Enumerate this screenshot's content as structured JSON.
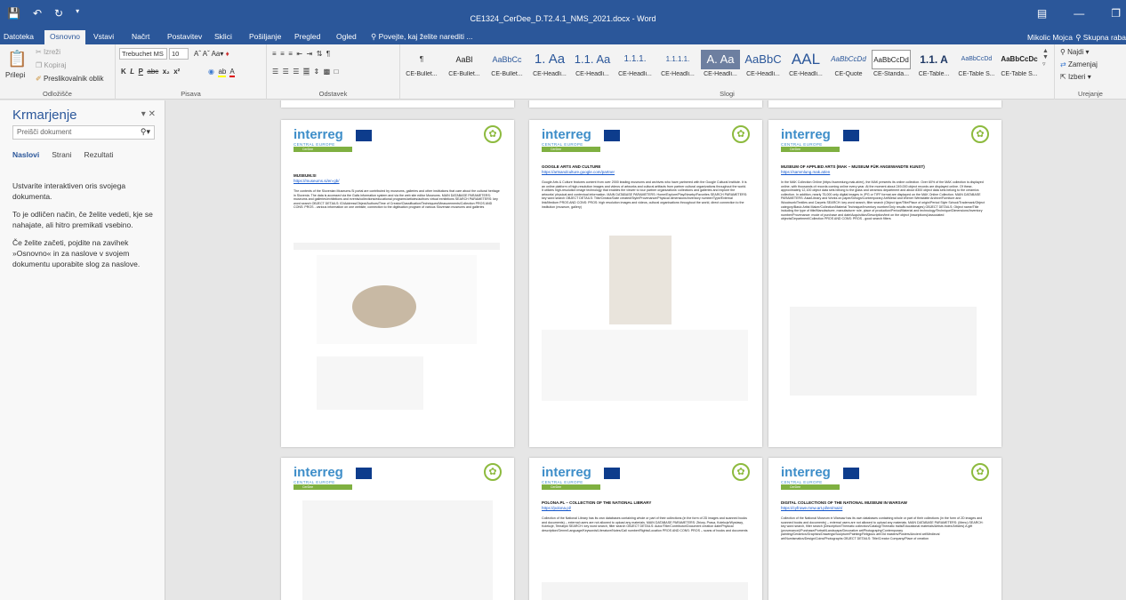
{
  "title_bar": {
    "quick_access": [
      "save-icon",
      "undo-icon",
      "redo-icon"
    ],
    "doc_title": "CE1324_CerDee_D.T2.4.1_NMS_2021.docx - Word",
    "window": [
      "ribbon-display-icon",
      "minimize-icon",
      "restore-icon"
    ]
  },
  "tabs": [
    "Datoteka",
    "Osnovno",
    "Vstavi",
    "Načrt",
    "Postavitev",
    "Sklici",
    "Pošiljanje",
    "Pregled",
    "Ogled",
    "Povejte, kaj želite narediti ..."
  ],
  "user": "Mikolic Mojca",
  "share": "Skupna raba",
  "ribbon": {
    "clipboard": {
      "paste": "Prilepi",
      "cut": "Izreži",
      "copy": "Kopiraj",
      "format_painter": "Preslikovalnik oblik",
      "label": "Odložišče"
    },
    "font": {
      "name": "Trebuchet MS",
      "size": "10",
      "buttons": [
        "K",
        "L",
        "P",
        "abc",
        "x₂",
        "x²"
      ],
      "label": "Pisava"
    },
    "paragraph": {
      "label": "Odstavek"
    },
    "styles": {
      "label": "Slogi",
      "items": [
        {
          "preview": "¶",
          "name": "CE-Bullet..."
        },
        {
          "preview": "AaBl",
          "name": "CE-Bullet..."
        },
        {
          "preview": "AaBbCc",
          "name": "CE-Bullet..."
        },
        {
          "preview": "1. Aa",
          "name": "CE-Headli..."
        },
        {
          "preview": "1.1. Aa",
          "name": "CE-Headli..."
        },
        {
          "preview": "1.1.1.",
          "name": "CE-Headli..."
        },
        {
          "preview": "1.1.1.1.",
          "name": "CE-Headli..."
        },
        {
          "preview": "A. Aa",
          "name": "CE-Headli..."
        },
        {
          "preview": "AaBbC",
          "name": "CE-Headli..."
        },
        {
          "preview": "AAL",
          "name": "CE-Headli..."
        },
        {
          "preview": "AaBbCcDd",
          "name": "CE-Quote"
        },
        {
          "preview": "AaBbCcDd",
          "name": "CE-Standa..."
        },
        {
          "preview": "1.1. A",
          "name": "CE-Table..."
        },
        {
          "preview": "AaBbCcDd",
          "name": "CE-Table S..."
        },
        {
          "preview": "AaBbCcDc",
          "name": "CE-Table S..."
        }
      ]
    },
    "editing": {
      "find": "Najdi",
      "replace": "Zamenjaj",
      "select": "Izberi",
      "label": "Urejanje"
    }
  },
  "nav_pane": {
    "title": "Krmarjenje",
    "search_placeholder": "Preišči dokument",
    "tabs": [
      "Naslovi",
      "Strani",
      "Rezultati"
    ],
    "p1": "Ustvarite interaktiven oris svojega dokumenta.",
    "p2": "To je odličen način, če želite vedeti, kje se nahajate, ali hitro premikati vsebino.",
    "p3": "Če želite začeti, pojdite na zavihek »Osnovno« in za naslove v svojem dokumentu uporabite slog za naslove."
  },
  "pages": [
    {
      "title": "MUSEUM.SI",
      "link": "https://museums.si/en-gb/",
      "body": "The contents of the Slovenian Museums.Si portal are contributed by museums, galleries and other institutions that care about the cultural heritage in Slovenia. The data is accessed via the Galis information system and via the web site editor Museums. MAIN DATABASE PARAMETERS: museums and galleries/exhibitions and events/collections/educational programs/articles/authors virtual exhibitions SEARCH PARAMETERS: key word search OBJECT DETAILS: ID/Address/Object/Authors/Time of Creator/Classification/Techniques/Measurements/Collection PROS AND CONS: PROS - various information on one website, connection to the digitisation program of various Slovenian museums and galleries"
    },
    {
      "title": "GOOGLE ARTS AND CULTURE",
      "link": "https://artsandculture.google.com/partner",
      "body": "Google Arts & Culture features content from over 2000 leading museums and archives who have partnered with the Google Cultural Institute. It is an online platform of high-resolution images and videos of artworks and cultural artifacts from partner cultural organizations throughout the world. It utilizes high-resolution image technology that enables the viewer to tour partner organizations' collections and galleries and explore the artworks' physical and contextual information. MAIN DATABASE PARAMETERS: Home/Explore/Play/Nearby/Favorites SEARCH PARAMETERS: key word search OBJECT DETAILS: Title/Creator/Date created/Style/Provenance/Physical dimensions/Inventory number/Type/External link/Medium PROS AND CONS: PROS: high resolution images and videos, cultural organisations throughout the world, direct connection to the institution (museum, gallery)"
    },
    {
      "title": "MUSEUM OF APPLIED ARTS (MAK – MUSEUM FÜR ANGEWANDTE KUNST)",
      "link": "https://sammlung.mak.at/en",
      "body": "In the MAK Collection Online (https://sammlung.mak.at/en), the MAK presents its online collection. Over 60% of the MAK collection is displayed online, with thousands of records coming online every year. At the moment about 249,000 object records are displayed online. Of these, approximately 12,100 object data sets belong to the glass and ceramics department and about 8300 object data sets belong to the ceramics collection. In addition, nearly 75,000 only digital images in JPG or TIFF format are displayed on the MAK Online Collection. MAIN DATABASE PARAMETERS: Asia/Library and Works on paper/Design/Contemporary Art/Metal and Wiener Werkstätte Archive/Furniture and Woodwork/Textiles and Carpets SEARCH: key word search, filter search (Object type/Title/Place of origin/Period Style School/Trademark/Object category/Basic Artist Maker/Collection/Material Technique/Inventory number/Only results with images) OBJECT DETAILS: Object name/Title including the type of title/Manufacturer, manufacturer role, place of production/Period/Material and technology/Technique/Dimensions/Inventory number/Provenance: mode of purchase and date/Acquisition/Description/text on the object (inscriptions)/associated objects/Department/Collection PROS AND CONS: PROS - good search filters"
    },
    {
      "title": "",
      "link": "",
      "body": ""
    },
    {
      "title": "POLONA.PL – COLLECTION OF THE NATIONAL LIBRARY",
      "link": "https://polona.pl/",
      "body": "Collection of the National Library has its own databases containing whole or part of their collections (in the form of 2D images and scanned books and documents) – external users are not allowed to upload any materials. MAIN DATABASE PARAMETERS: Zbiory, Prasa, Kolekcje/Wystawy, Kolekcje, Tematyki SEARCH: key word search, filter search OBJECT DETAILS: Autor/Title/Contributor/Document creation date/Physical description/Genre/Language/Keywords/Literature/Notes/Call number/Rights/Location PROS AND CONS: PROS – scans of books and documents"
    },
    {
      "title": "DIGITAL COLLECTIONS OF THE NATIONAL MUSEUM IN WARSAW",
      "link": "https://cyfrowe.mnw.art.pl/en/main/",
      "body": "Collection of the National Museum in Warsaw has its own databases containing whole or part of their collections (in the form of 2D images and scanned books and documents) – external users are not allowed to upload any materials. MAIN DATABASE PARAMETERS: (Menu) SEARCH: key word search, filter search (Description/Thematic collection/Catalog/Thematic trails/Educational materials/Artists index/Articles) A gift (provenance)/Purchase/Portrait/Landscape/Decorative art/Photography/Contemporary painting/Ceramics/Graphics/Drawings/Sculpture/Painting/Religious art/Old masters/Posters/Ancient art/Medieval art/Numismatics/Design/Coins/Photographs OBJECT DETAILS: Title/Creator Company/Place of creation"
    }
  ]
}
